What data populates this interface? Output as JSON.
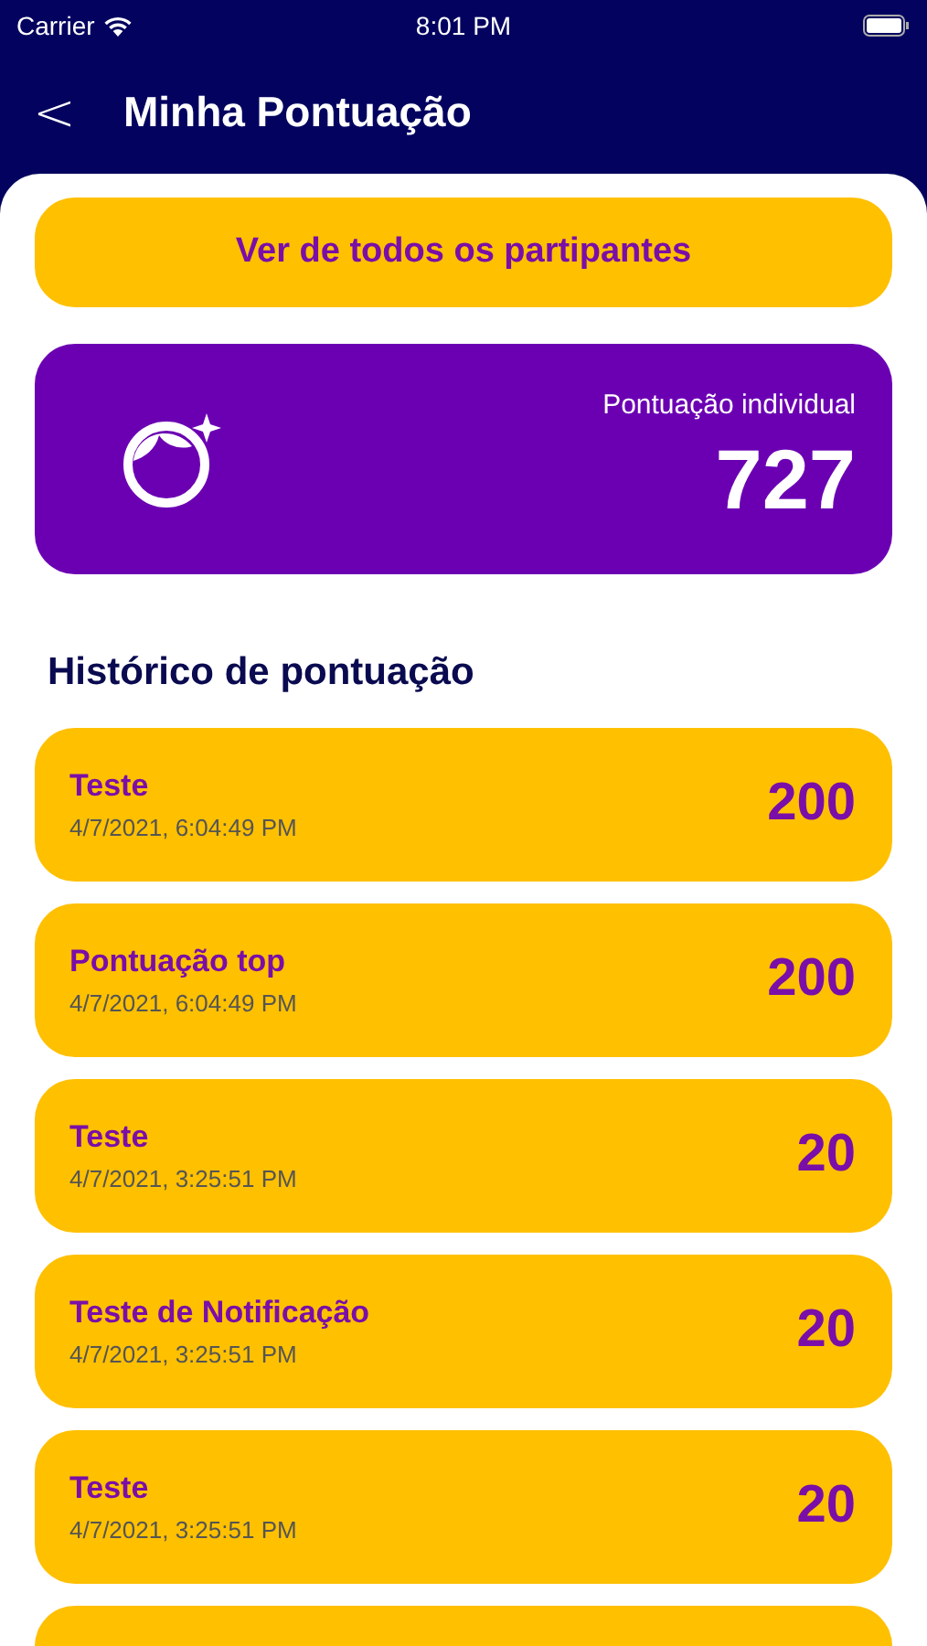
{
  "status_bar": {
    "carrier": "Carrier",
    "time": "8:01 PM"
  },
  "header": {
    "back": "<",
    "title": "Minha Pontuação"
  },
  "all_participants_button": "Ver de todos os partipantes",
  "score_card": {
    "label": "Pontuação individual",
    "value": "727"
  },
  "history": {
    "title": "Histórico de pontuação",
    "items": [
      {
        "title": "Teste",
        "date": "4/7/2021, 6:04:49 PM",
        "points": "200"
      },
      {
        "title": "Pontuação top",
        "date": "4/7/2021, 6:04:49 PM",
        "points": "200"
      },
      {
        "title": "Teste",
        "date": "4/7/2021, 3:25:51 PM",
        "points": "20"
      },
      {
        "title": "Teste de Notificação",
        "date": "4/7/2021, 3:25:51 PM",
        "points": "20"
      },
      {
        "title": "Teste",
        "date": "4/7/2021, 3:25:51 PM",
        "points": "20"
      }
    ]
  }
}
